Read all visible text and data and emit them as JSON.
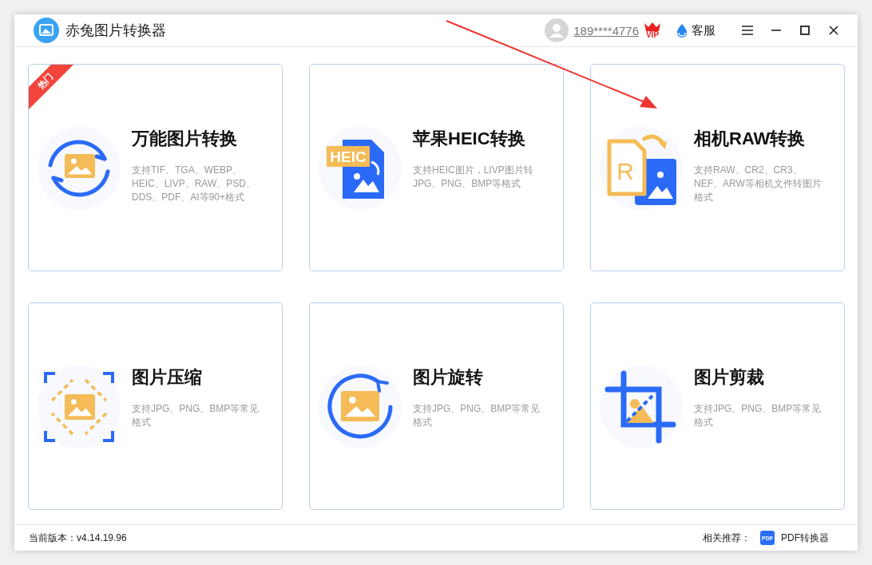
{
  "window": {
    "title": "赤兔图片转换器"
  },
  "account": {
    "phone": "189****4776",
    "vip_badge": "VIP"
  },
  "support": {
    "label": "客服"
  },
  "cards": [
    {
      "kind": "convert",
      "title": "万能图片转换",
      "description": "支持TIF、TGA、WEBP、HEIC、LIVP、RAW、PSD、DDS、PDF、AI等90+格式",
      "badge": "热门"
    },
    {
      "kind": "heic",
      "title": "苹果HEIC转换",
      "description": "支持HEIC图片，LIVP图片转JPG、PNG、BMP等格式",
      "icon_text": "HEIC"
    },
    {
      "kind": "raw",
      "title": "相机RAW转换",
      "description": "支持RAW、CR2、CR3、NEF、ARW等相机文件转图片格式",
      "icon_text": "R"
    },
    {
      "kind": "compress",
      "title": "图片压缩",
      "description": "支持JPG、PNG、BMP等常见格式"
    },
    {
      "kind": "rotate",
      "title": "图片旋转",
      "description": "支持JPG、PNG、BMP等常见格式"
    },
    {
      "kind": "crop",
      "title": "图片剪裁",
      "description": "支持JPG、PNG、BMP等常见格式"
    }
  ],
  "status_bar": {
    "version": "当前版本：v4.14.19.96",
    "related_label": "相关推荐：",
    "related_icon_text": "PDF",
    "related_link": "PDF转换器"
  }
}
